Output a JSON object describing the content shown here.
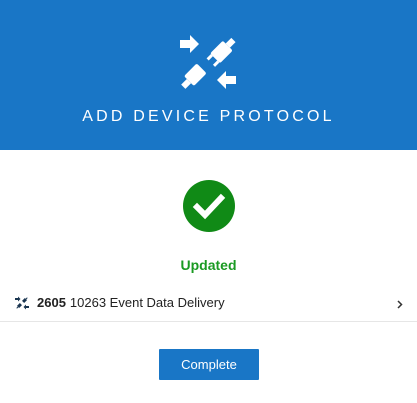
{
  "header": {
    "title": "ADD DEVICE PROTOCOL",
    "icon": "plug-connect-icon",
    "background_color": "#1976c6"
  },
  "status": {
    "icon": "check-circle-icon",
    "text": "Updated",
    "color": "#1a9a22"
  },
  "device": {
    "icon": "plug-connect-icon",
    "id": "2605",
    "name": "10263 Event Data Delivery",
    "chevron_icon": "chevron-right-icon"
  },
  "actions": {
    "complete_label": "Complete"
  }
}
